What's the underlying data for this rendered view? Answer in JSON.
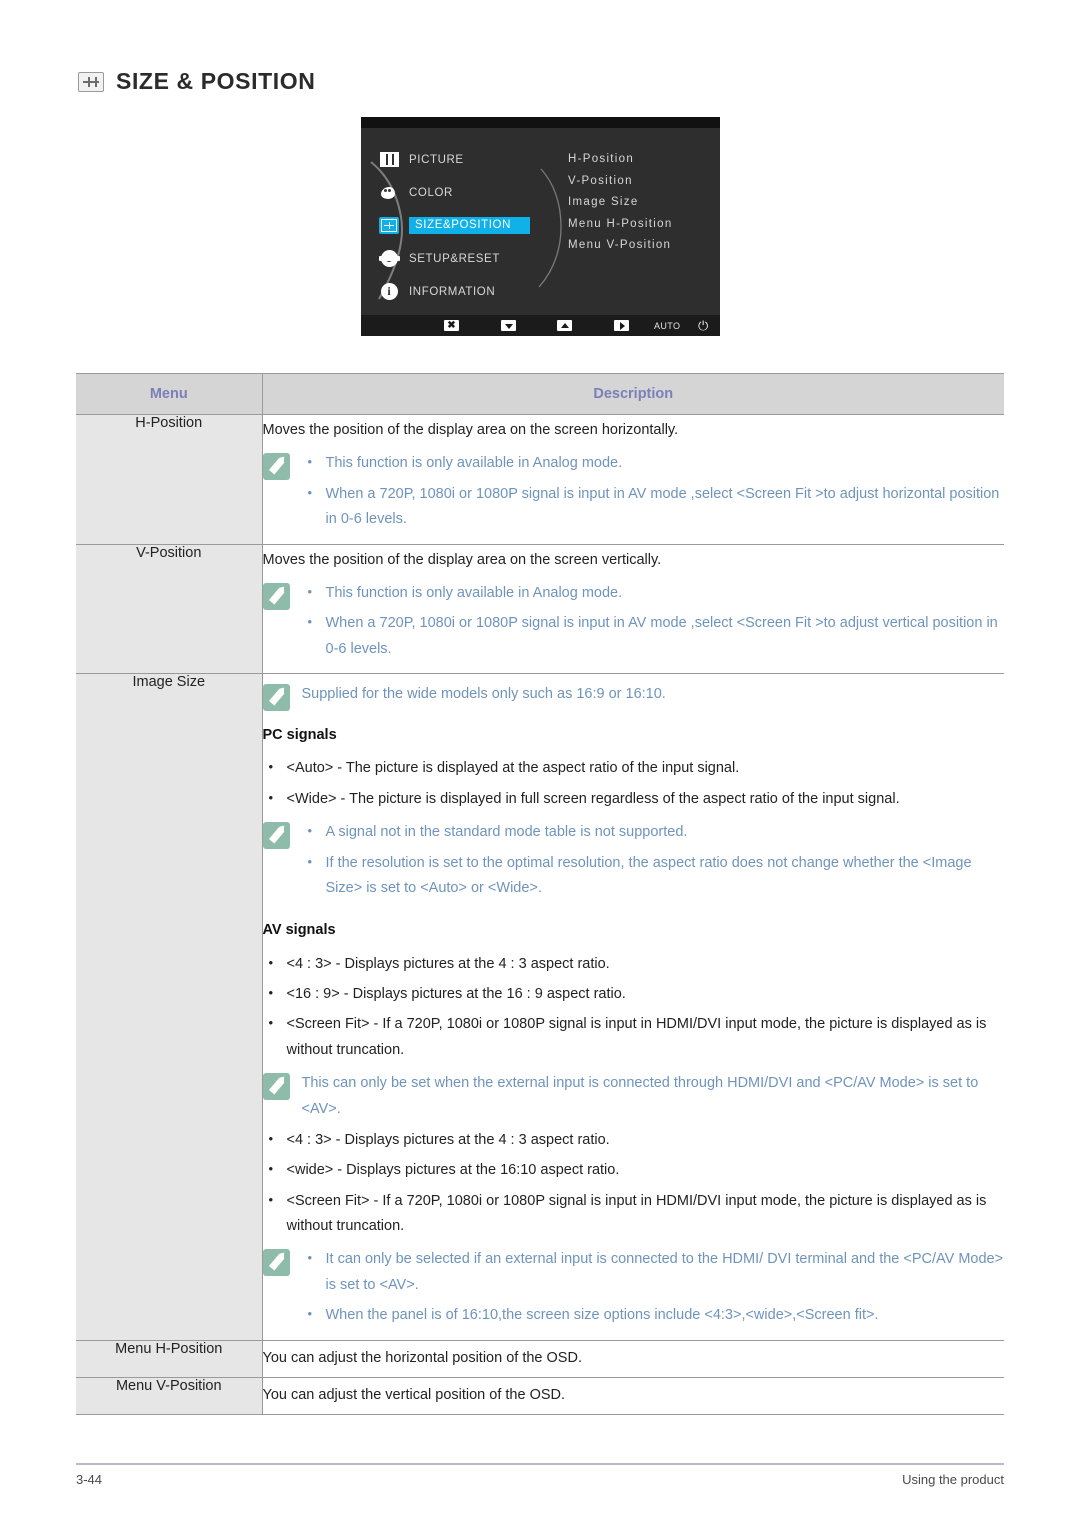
{
  "page": {
    "title": "SIZE & POSITION",
    "title_icon": "size-position-icon",
    "footer_page_number": "3-44",
    "footer_section": "Using the product"
  },
  "osd": {
    "menu_items": [
      {
        "label": "PICTURE",
        "icon": "picture-icon",
        "selected": false
      },
      {
        "label": "COLOR",
        "icon": "color-icon",
        "selected": false
      },
      {
        "label": "SIZE&POSITION",
        "icon": "size-position-icon",
        "selected": true
      },
      {
        "label": "SETUP&RESET",
        "icon": "gear-icon",
        "selected": false
      },
      {
        "label": "INFORMATION",
        "icon": "info-icon",
        "selected": false
      }
    ],
    "submenu_items": [
      "H-Position",
      "V-Position",
      "Image Size",
      "Menu H-Position",
      "Menu V-Position"
    ],
    "toolbar": [
      {
        "name": "exit-button",
        "glyph": "✖"
      },
      {
        "name": "down-button",
        "glyph": "▼"
      },
      {
        "name": "up-button",
        "glyph": "▲"
      },
      {
        "name": "enter-button",
        "glyph": "▶"
      },
      {
        "name": "auto-button",
        "glyph": "AUTO"
      },
      {
        "name": "power-button",
        "glyph": "⏻"
      }
    ],
    "highlight_color": "#0fb2e8",
    "background_color": "#2e2e2e"
  },
  "table": {
    "headers": {
      "menu": "Menu",
      "description": "Description"
    },
    "rows": [
      {
        "menu": "H-Position",
        "intro": "Moves the position of the display area on the screen horizontally.",
        "note_bullets": [
          "This function is only available in Analog mode.",
          "When a 720P, 1080i or 1080P signal is input in AV mode ,select <Screen Fit  >to adjust horizontal position in 0-6 levels."
        ]
      },
      {
        "menu": "V-Position",
        "intro": "Moves the position of the display area on the screen vertically.",
        "note_bullets": [
          "This function is only available in Analog mode.",
          "When a 720P, 1080i or 1080P signal is input in AV mode ,select <Screen Fit  >to adjust vertical position in 0-6 levels."
        ]
      },
      {
        "menu": "Image Size",
        "note_plain_1": "Supplied for the wide models only such as 16:9 or 16:10.",
        "subhead_pc": "PC signals",
        "pc_bullets": [
          "<Auto> - The picture is displayed at the aspect ratio of the input signal.",
          "<Wide> - The picture is displayed in full screen regardless of the aspect ratio of the input signal."
        ],
        "note_bullets_2": [
          "A signal not in the standard mode table is not supported.",
          "If the resolution is set to the optimal resolution, the aspect ratio does not change whether the <Image Size> is set to <Auto> or <Wide>."
        ],
        "subhead_av": "AV signals",
        "av_bullets_1": [
          "<4 : 3> - Displays pictures at the 4 : 3 aspect ratio.",
          "<16 : 9> - Displays pictures at the 16 : 9 aspect ratio.",
          "<Screen Fit> - If a 720P, 1080i or 1080P signal is input in HDMI/DVI input mode, the picture is displayed as is without truncation."
        ],
        "note_plain_2": "This can only be set when the external input is connected through HDMI/DVI and <PC/AV Mode> is set to <AV>.",
        "av_bullets_2": [
          "<4 : 3> - Displays pictures at the 4 : 3 aspect ratio.",
          "<wide> - Displays pictures at the 16:10 aspect ratio.",
          "<Screen Fit> - If a 720P, 1080i or 1080P signal is input in HDMI/DVI input mode, the picture is displayed as is without truncation."
        ],
        "note_bullets_3": [
          "It can only be selected if an external input is connected to the HDMI/ DVI terminal and the <PC/AV Mode> is set to <AV>.",
          "When the panel is of 16:10,the screen size options include <4:3>,<wide>,<Screen fit>."
        ]
      },
      {
        "menu": "Menu H-Position",
        "intro": "You can adjust the horizontal position of the OSD."
      },
      {
        "menu": "Menu V-Position",
        "intro": "You can adjust the vertical position of the OSD."
      }
    ]
  },
  "colors": {
    "note_text": "#6e94bd",
    "note_icon_bg": "#8fbcaa",
    "header_bg": "#d5d5d5",
    "header_text": "#7c7fb8",
    "menu_cell_bg": "#e6e6e6"
  }
}
